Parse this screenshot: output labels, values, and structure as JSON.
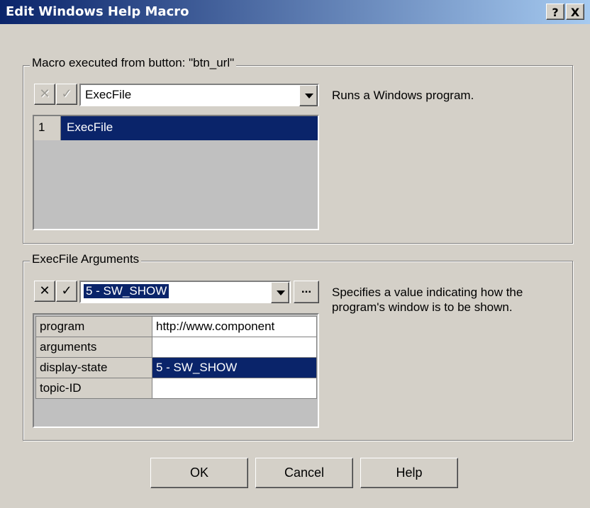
{
  "window": {
    "title": "Edit Windows Help Macro",
    "help_btn": "?",
    "close_btn": "X"
  },
  "macro_group": {
    "legend": "Macro executed from button: \"btn_url\"",
    "combo_value": "ExecFile",
    "description": "Runs a Windows program.",
    "list": [
      {
        "num": "1",
        "name": "ExecFile"
      }
    ]
  },
  "args_group": {
    "legend": "ExecFile Arguments",
    "combo_value": "5 - SW_SHOW",
    "browse_label": "...",
    "description": "Specifies a value indicating how the program's window is to be shown.",
    "rows": [
      {
        "name": "program",
        "value": "http://www.component"
      },
      {
        "name": "arguments",
        "value": ""
      },
      {
        "name": "display-state",
        "value": "5 - SW_SHOW"
      },
      {
        "name": "topic-ID",
        "value": ""
      }
    ]
  },
  "buttons": {
    "ok": "OK",
    "cancel": "Cancel",
    "help": "Help"
  },
  "icons": {
    "cancel": "✕",
    "accept": "✓"
  },
  "colors": {
    "selection": "#0a246a",
    "title_start": "#0a246a",
    "title_end": "#a6caf0"
  }
}
